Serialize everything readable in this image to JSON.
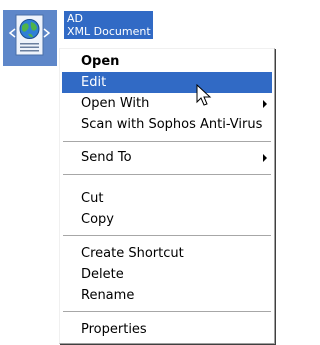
{
  "file": {
    "name": "AD",
    "type": "XML Document",
    "icon": "xml-document-globe-icon"
  },
  "context_menu": {
    "items": {
      "open": {
        "label": "Open",
        "bold": true
      },
      "edit": {
        "label": "Edit",
        "highlighted": true
      },
      "open_with": {
        "label": "Open With",
        "has_submenu": true
      },
      "scan": {
        "label": "Scan with Sophos Anti-Virus"
      },
      "send_to": {
        "label": "Send To",
        "has_submenu": true
      },
      "cut": {
        "label": "Cut"
      },
      "copy": {
        "label": "Copy"
      },
      "create_shortcut": {
        "label": "Create Shortcut"
      },
      "delete": {
        "label": "Delete"
      },
      "rename": {
        "label": "Rename"
      },
      "properties": {
        "label": "Properties"
      }
    }
  },
  "colors": {
    "selection": "#316ac5",
    "menu_background": "#ffffff",
    "separator": "#a7a7a7"
  },
  "cursor": "arrow-cursor-icon"
}
